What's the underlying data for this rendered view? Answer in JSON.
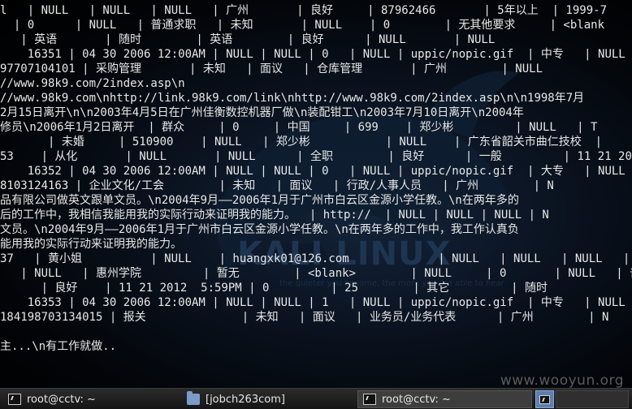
{
  "terminal": {
    "lines": [
      "l   | NULL   | NULL   | NULL   | 广州       | 良好     | 87962466       | 5年以上  | 1999-7",
      "  | 0      | NULL   | 普通求职   | 未知       | NULL    | 0        | 无其他要求     | <blank",
      "   | 英语       | 随时        | 英语        | 良好      | NULL       | NULL",
      "    16351 | 04 30 2006 12:00AM | NULL | NULL | 0   | NULL | uppic/nopic.gif  | 中专   | NULL",
      "97707104101 | 采购管理       | 未知   | 面议   | 仓库管理       | 广州        | NULL",
      "//www.98k9.com/2index.asp\\n",
      "//www.98k9.com\\nhttp://link.98k9.com/link\\nhttp://www.98k9.com/2index.asp\\n\\n1998年7月",
      "2月15日离开\\n\\n2003年4月5日在广州佳衡数控机器厂做\\n装配钳工\\n2003年7月10日离开\\n2004年",
      "修员\\n2006年1月2日离开  | 群众     | 0     | 中国     | 699    | 郑少彬         | NULL   | T",
      "       | 未婚     | 510900    | NULL   | 郑少彬           | NULL    | 广东省韶关市曲仁技校  |",
      "53    | 从化       | NULL       | NULL      | 全职        | 良好      | 一般         | 11 21 20",
      "    16352 | 04 30 2006 12:00AM | NULL | NULL | 0   | NULL | uppic/nopic.gif  | 大专   | NULL",
      "8103124163 | 企业文化/工会        | 未知   | 面议   | 行政/人事人员   | 广州        | N",
      "品有限公司做英文跟单文员。\\n2004年9月——2006年1月于广州市白云区金源小学任教。\\n在两年多的",
      "后的工作中，我相信我能用我的实际行动来证明我的能力。  | http://  | NULL | NULL | NULL | N",
      "文员。\\n2004年9月——2006年1月于广州市白云区金源小学任教。\\n在两年多的工作中，我工作认真负",
      "能用我的实际行动来证明我的能力。",
      "37   | 黄小姐          | NULL    | huangxk01@126.com             | NULL   | NULL   | NULL   | N",
      "   | NULL   | 惠州学院         | 暂无        | <blank>        | NULL     | 0       | NULL   | 普通求",
      "      | 良好    | 11 21 2012  5:59PM | 0         | 25        | 其它         | 随时",
      "    16353 | 04 30 2006 12:00AM | NULL | NULL | 1   | NULL | uppic/nopic.gif  | 中专   | NULL",
      "184198703134015 | 报关              | 未知   | 面议   | 业务员/业务代表      | 广州        | N",
      "",
      "主...\\n有工作就做.."
    ],
    "logo_text": "KALI LINUX",
    "logo_subtext": "the quieter you become, the more you are able to hear"
  },
  "watermark": "www.wooyun.org",
  "taskbar": {
    "items": [
      {
        "label": "root@cctv: ~",
        "icon": "terminal-icon"
      },
      {
        "label": "[jobch263com]",
        "icon": "folder-icon"
      },
      {
        "label": "root@cctv: ~",
        "icon": "terminal-icon"
      }
    ],
    "workspace_icon": "terminal-icon"
  },
  "colors": {
    "text": "#e8e8e8",
    "background": "#000000",
    "taskbar": "#1e1e1e",
    "workspace_active": "#5b7fb0"
  }
}
